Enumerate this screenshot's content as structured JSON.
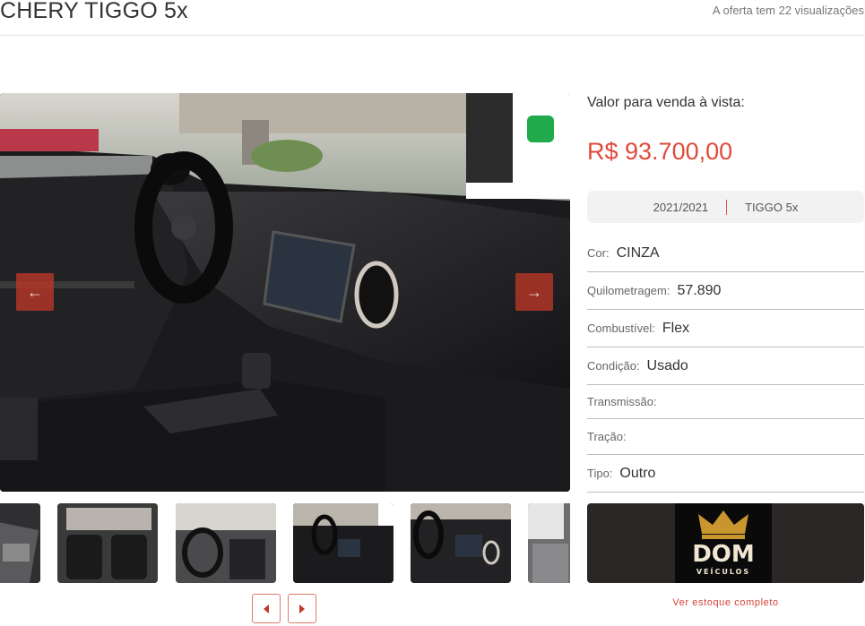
{
  "header": {
    "title": "CHERY TIGGO 5x",
    "views_text": "A oferta tem 22 visualizações"
  },
  "gallery": {
    "prev_icon": "arrow-left-icon",
    "next_icon": "arrow-right-icon",
    "thumbnail_count": 6
  },
  "pricing": {
    "label": "Valor para venda à vista:",
    "value": "R$ 93.700,00"
  },
  "tags": {
    "year": "2021/2021",
    "model": "TIGGO 5x"
  },
  "specs": [
    {
      "label": "Cor:",
      "value": "CINZA"
    },
    {
      "label": "Quilometragem:",
      "value": "57.890"
    },
    {
      "label": "Combustível:",
      "value": "Flex"
    },
    {
      "label": "Condição:",
      "value": "Usado"
    },
    {
      "label": "Transmissão:",
      "value": ""
    },
    {
      "label": "Tração:",
      "value": ""
    },
    {
      "label": "Tipo:",
      "value": "Outro"
    }
  ],
  "dealer": {
    "logo_line1": "DOM",
    "logo_line2": "VEÍCULOS",
    "stock_link": "Ver estoque completo"
  },
  "colors": {
    "accent": "#e04a3a",
    "arrow_bg": "#be3728",
    "dealer_bg": "#2a2726"
  }
}
